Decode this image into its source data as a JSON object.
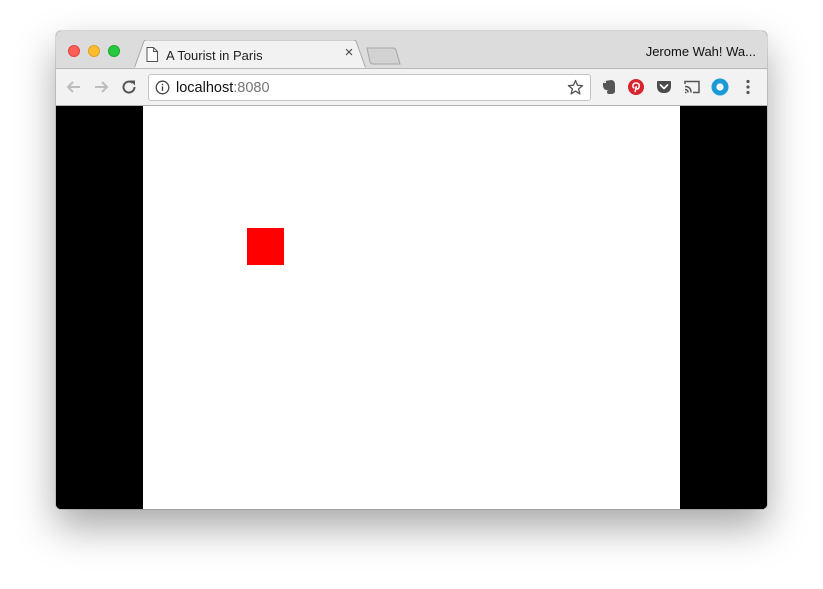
{
  "tab": {
    "title": "A Tourist in Paris",
    "close_label": "×"
  },
  "profile": {
    "name": "Jerome Wah! Wa..."
  },
  "address_bar": {
    "host": "localhost",
    "port": ":8080"
  },
  "icons": {
    "back": "back-arrow-icon",
    "forward": "forward-arrow-icon",
    "reload": "reload-icon",
    "info": "info-icon",
    "bookmark": "star-icon",
    "evernote": "evernote-icon",
    "pinterest": "pinterest-icon",
    "pocket": "pocket-icon",
    "cast": "cast-icon",
    "extension": "circle-extension-icon",
    "menu": "menu-dots-icon"
  },
  "colors": {
    "sprite": "#ff0000",
    "letterbox": "#000000",
    "stage": "#ffffff",
    "pinterest": "#d9232d",
    "pocket": "#4b4b4b",
    "extension": "#1a9bd7"
  }
}
